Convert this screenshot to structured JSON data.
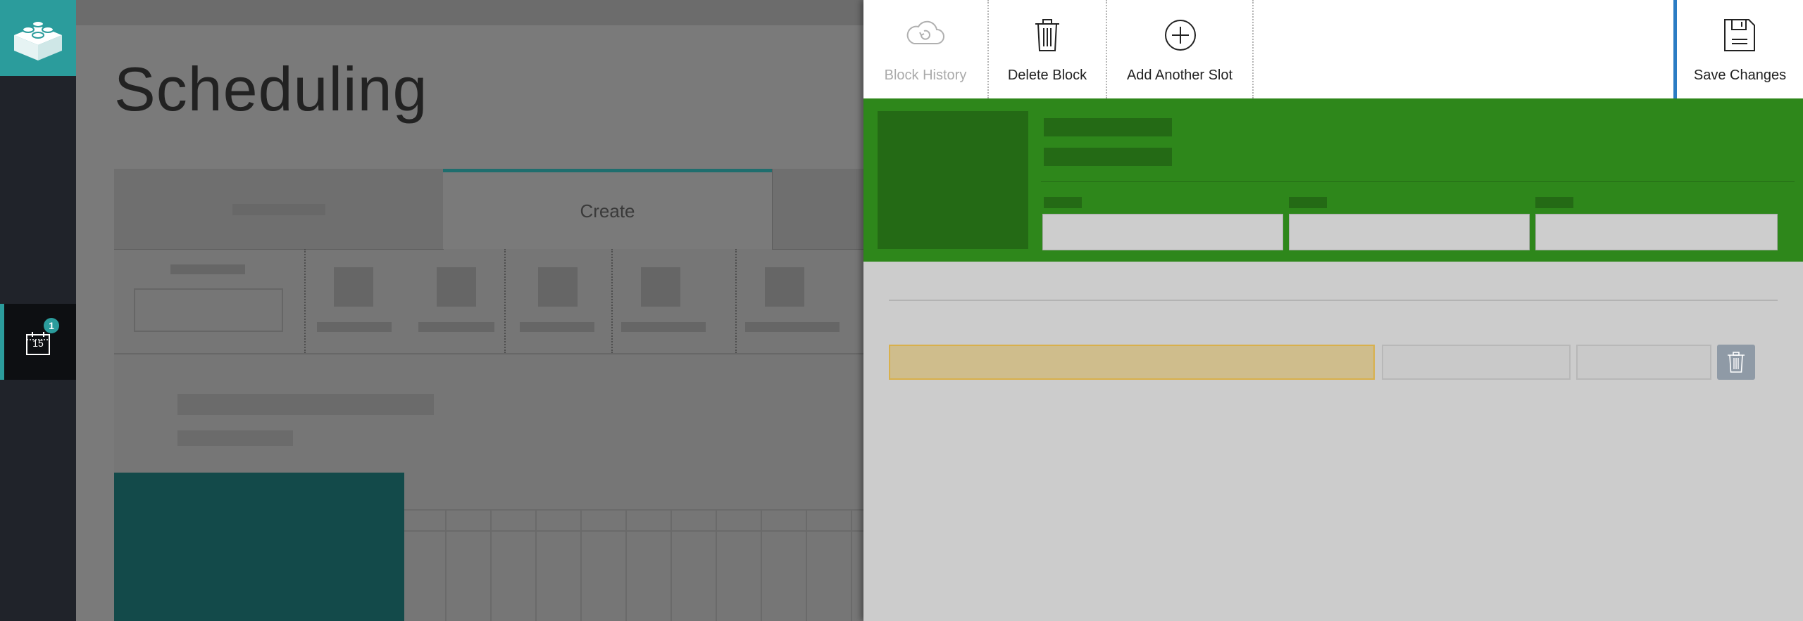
{
  "nav": {
    "badge_count": "1",
    "calendar_day": "15",
    "logo_icon": "stacked-blocks-icon",
    "calendar_icon": "calendar-icon"
  },
  "background_page": {
    "title": "Scheduling",
    "active_tab": "Create"
  },
  "panel": {
    "toolbar": {
      "block_history": "Block History",
      "delete_block": "Delete Block",
      "add_another_slot": "Add Another Slot",
      "save_changes": "Save Changes"
    },
    "colors": {
      "header_green": "#2e871b",
      "save_accent": "#2b7cc4",
      "slot_highlight": "#cfbd8c",
      "brand_teal": "#2b9c9c"
    }
  }
}
